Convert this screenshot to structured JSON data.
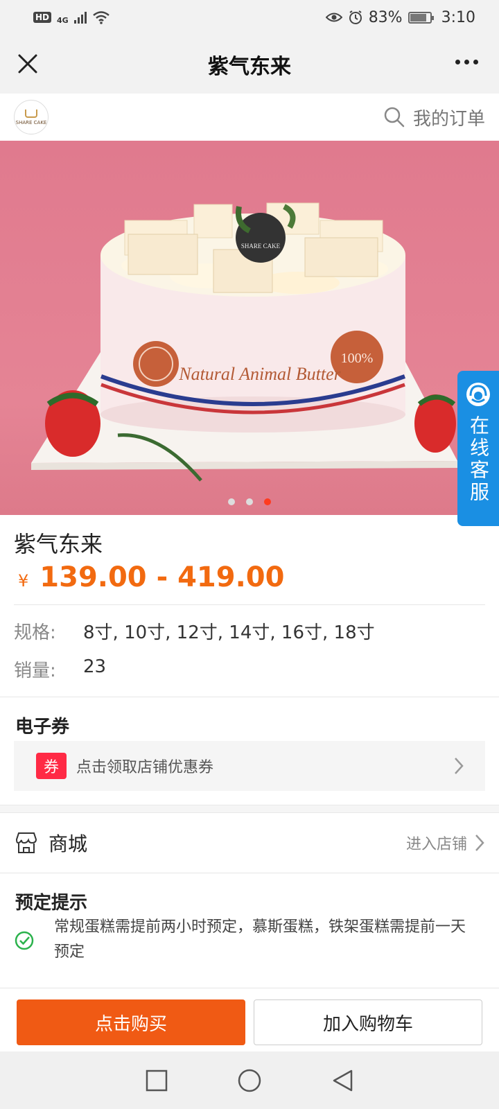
{
  "status_bar": {
    "hd": "HD",
    "network": "4G",
    "battery_level": 83,
    "battery_text": "83%",
    "time": "3:10"
  },
  "nav": {
    "title": "紫气东来",
    "left_icon": "close-icon",
    "right_icon": "more-icon"
  },
  "shop": {
    "logo_text": "SHARE CAKE",
    "orders_label": "我的订单",
    "search_icon": "search-icon"
  },
  "banner": {
    "plaque_text": "SHARE CAKE",
    "band_text": "Natural Animal Butter",
    "seal_text": "100%",
    "slide_count": 3,
    "active_slide": 3
  },
  "service_tab": {
    "label": "在线客服"
  },
  "product": {
    "title": "紫气东来",
    "currency": "¥",
    "price_range": "139.00 - 419.00",
    "spec_label": "规格:",
    "spec_value": "8寸, 10寸, 12寸, 14寸, 16寸, 18寸",
    "sales_label": "销量:",
    "sales_value": "23"
  },
  "coupon": {
    "section_title": "电子券",
    "tag": "券",
    "text": "点击领取店铺优惠券"
  },
  "mall": {
    "label": "商城",
    "enter_label": "进入店铺"
  },
  "notice": {
    "title": "预定提示",
    "text": "常规蛋糕需提前两小时预定，慕斯蛋糕，铁架蛋糕需提前一天预定"
  },
  "actions": {
    "buy_label": "点击购买",
    "cart_label": "加入购物车"
  },
  "colors": {
    "accent": "#f05a14",
    "price": "#f26a10",
    "service": "#1a8fe3",
    "coupon_tag": "#ff2a45",
    "banner_bg": "#e58495"
  }
}
